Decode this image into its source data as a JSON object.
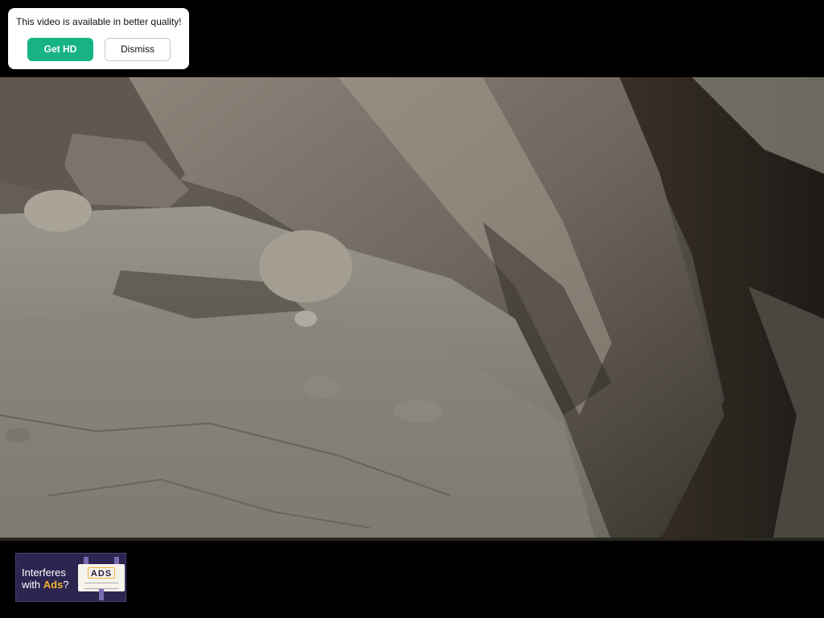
{
  "popup": {
    "message": "This video is available in better quality!",
    "primary_button": "Get HD",
    "secondary_button": "Dismiss",
    "primary_color": "#18b384"
  },
  "ad": {
    "line1": "Interferes",
    "line2_prefix": "with ",
    "line2_highlight": "Ads",
    "line2_suffix": "?",
    "sign_word": "ADS",
    "highlight_color": "#f2b233",
    "background_color": "#2c2550"
  },
  "video": {
    "scene": "rocky-outcrop-footage"
  }
}
